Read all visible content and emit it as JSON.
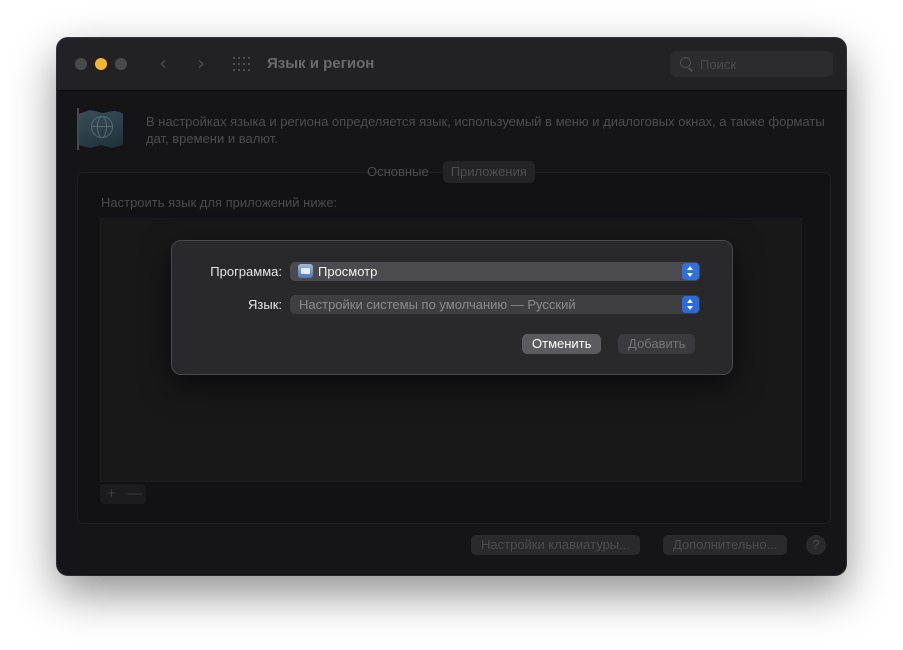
{
  "window": {
    "title": "Язык и регион",
    "search_placeholder": "Поиск"
  },
  "intro_text": "В настройках языка и региона определяется язык, используемый в меню и диалоговых окнах, а также форматы дат, времени и валют.",
  "tabs": [
    {
      "label": "Основные",
      "active": false
    },
    {
      "label": "Приложения",
      "active": true
    }
  ],
  "apps_panel": {
    "label": "Настроить язык для приложений ниже:",
    "plus": "+",
    "minus": "—"
  },
  "bottom_buttons": {
    "keyboard": "Настройки клавиатуры...",
    "advanced": "Дополнительно...",
    "help": "?"
  },
  "sheet": {
    "program_label": "Программа:",
    "program_value": "Просмотр",
    "language_label": "Язык:",
    "language_value": "Настройки системы по умолчанию — Русский",
    "cancel": "Отменить",
    "add": "Добавить"
  },
  "colors": {
    "accent": "#2f6fe0",
    "minimize": "#f5b730"
  }
}
